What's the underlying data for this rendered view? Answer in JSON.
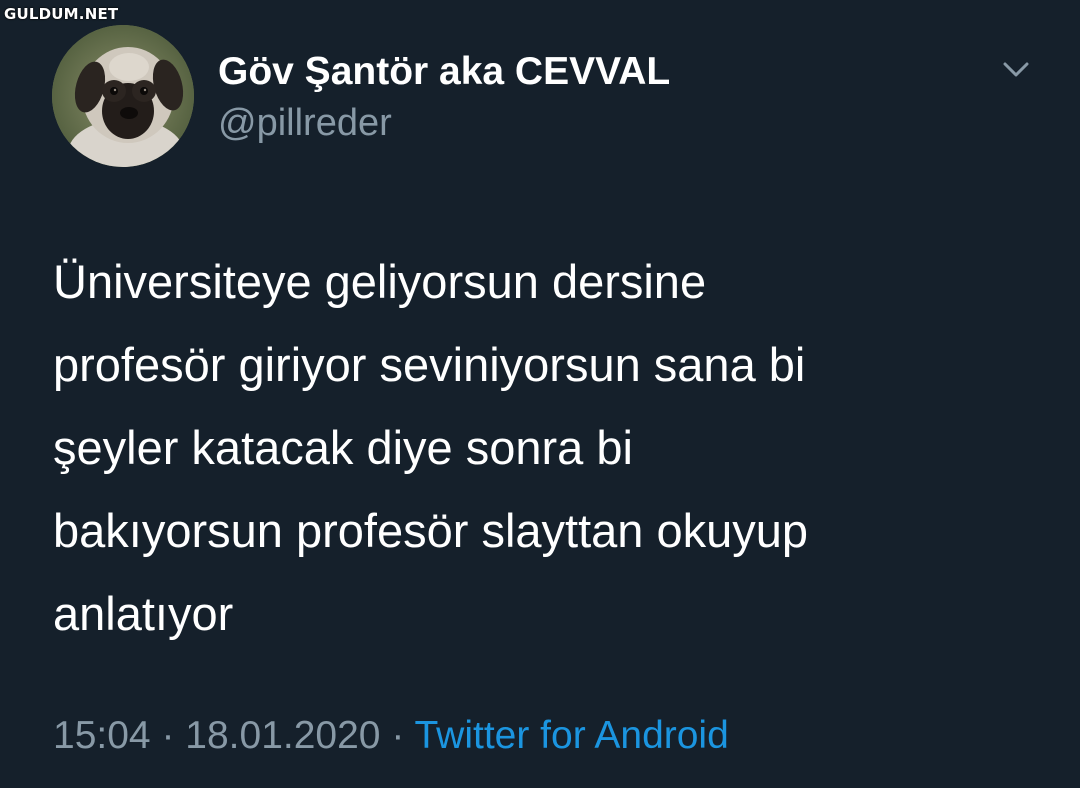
{
  "watermark": "GULDUM.NET",
  "tweet": {
    "display_name": "Göv Şantör aka CEVVAL",
    "username": "@pillreder",
    "text_lines": [
      "Üniversiteye geliyorsun dersine",
      "profesör giriyor seviniyorsun sana bi",
      "şeyler katacak diye sonra bi",
      "bakıyorsun profesör slayttan okuyup",
      "anlatıyor"
    ],
    "time": "15:04",
    "separator": "·",
    "date": "18.01.2020",
    "source": "Twitter for Android"
  },
  "icons": {
    "avatar": "puppy-avatar",
    "menu": "chevron-down-icon"
  },
  "colors": {
    "background": "#15202b",
    "secondary_text": "#8899a6",
    "link": "#1b95e0"
  }
}
